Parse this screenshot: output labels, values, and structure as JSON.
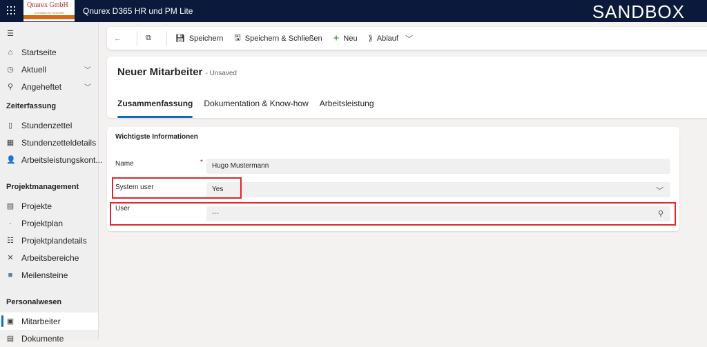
{
  "topbar": {
    "logo_text": "Qnurex GmbH",
    "logo_tagline": "Innovation ist Fortschritt",
    "app_title": "Qnurex D365 HR und PM Lite",
    "environment": "SANDBOX"
  },
  "sidebar": {
    "items": [
      {
        "label": "Startseite",
        "icon": "home-icon"
      },
      {
        "label": "Aktuell",
        "icon": "clock-icon",
        "chevron": true
      },
      {
        "label": "Angeheftet",
        "icon": "pin-icon",
        "chevron": true
      }
    ],
    "sections": [
      {
        "title": "Zeiterfassung",
        "items": [
          {
            "label": "Stundenzettel",
            "icon": "timesheet-icon"
          },
          {
            "label": "Stundenzetteldetails",
            "icon": "calendar-icon"
          },
          {
            "label": "Arbeitsleistungskont...",
            "icon": "person-icon"
          }
        ]
      },
      {
        "title": "Projektmanagement",
        "items": [
          {
            "label": "Projekte",
            "icon": "project-icon"
          },
          {
            "label": "Projektplan",
            "icon": "dot-icon"
          },
          {
            "label": "Projektplandetails",
            "icon": "list-icon"
          },
          {
            "label": "Arbeitsbereiche",
            "icon": "tools-icon"
          },
          {
            "label": "Meilensteine",
            "icon": "milestone-icon"
          }
        ]
      },
      {
        "title": "Personalwesen",
        "items": [
          {
            "label": "Mitarbeiter",
            "icon": "badge-icon",
            "selected": true
          },
          {
            "label": "Dokumente",
            "icon": "document-icon"
          }
        ]
      }
    ]
  },
  "toolbar": {
    "save": "Speichern",
    "save_close": "Speichern & Schließen",
    "new": "Neu",
    "flow": "Ablauf"
  },
  "form": {
    "title": "Neuer Mitarbeiter",
    "status": "- Unsaved",
    "tabs": [
      "Zusammenfassung",
      "Dokumentation & Know-how",
      "Arbeitsleistung"
    ],
    "active_tab": 0
  },
  "section": {
    "title": "Wichtigste Informationen",
    "fields": {
      "name_label": "Name",
      "name_value": "Hugo Mustermann",
      "system_user_label": "System user",
      "system_user_value": "Yes",
      "user_label": "User",
      "user_value": "---"
    }
  },
  "colors": {
    "accent": "#0f6cbd",
    "highlight": "#d9272e",
    "topbar": "#0b1a3b"
  }
}
